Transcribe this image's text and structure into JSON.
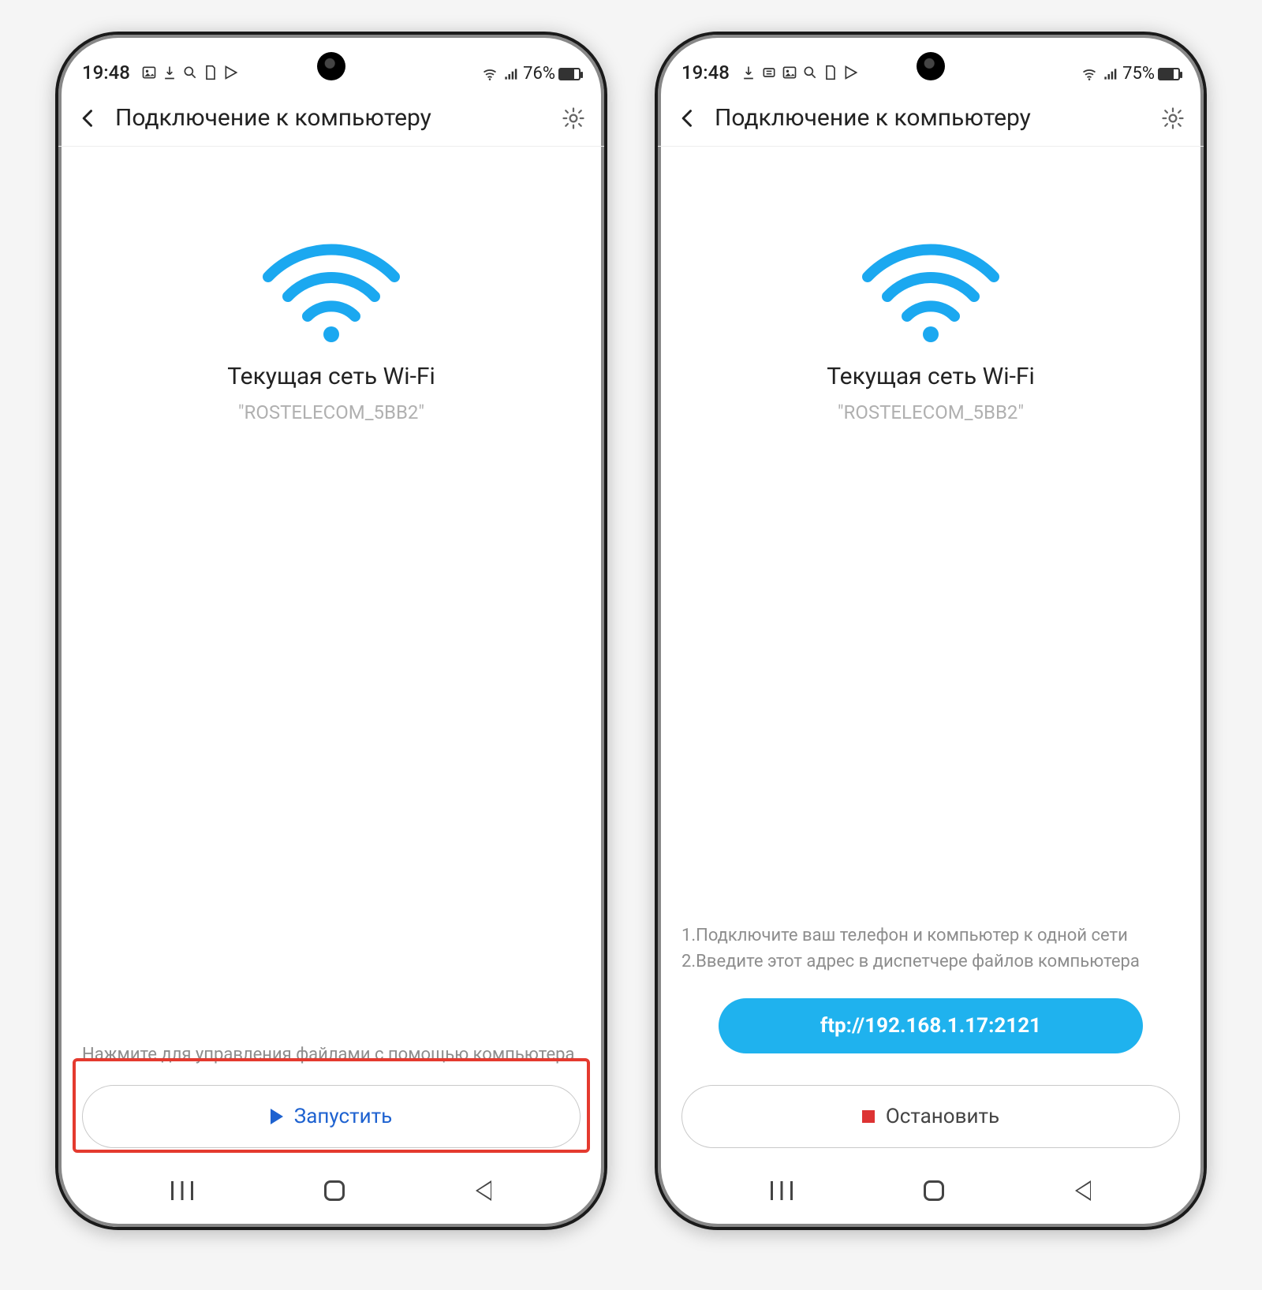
{
  "left": {
    "status": {
      "time": "19:48",
      "battery_pct": "76%",
      "battery_fill": 76
    },
    "header": {
      "title": "Подключение к компьютеру"
    },
    "wifi": {
      "label": "Текущая сеть Wi-Fi",
      "ssid": "\"ROSTELECOM_5BB2\""
    },
    "hint": "Нажмите для управления файлами с помощью компьютера",
    "action": {
      "label": "Запустить",
      "kind": "start"
    }
  },
  "right": {
    "status": {
      "time": "19:48",
      "battery_pct": "75%",
      "battery_fill": 75
    },
    "header": {
      "title": "Подключение к компьютеру"
    },
    "wifi": {
      "label": "Текущая сеть Wi-Fi",
      "ssid": "\"ROSTELECOM_5BB2\""
    },
    "instructions": {
      "line1": "1.Подключите ваш телефон и компьютер к одной сети",
      "line2": "2.Введите этот адрес в диспетчере файлов компьютера"
    },
    "ftp_address": "ftp://192.168.1.17:2121",
    "action": {
      "label": "Остановить",
      "kind": "stop"
    }
  }
}
